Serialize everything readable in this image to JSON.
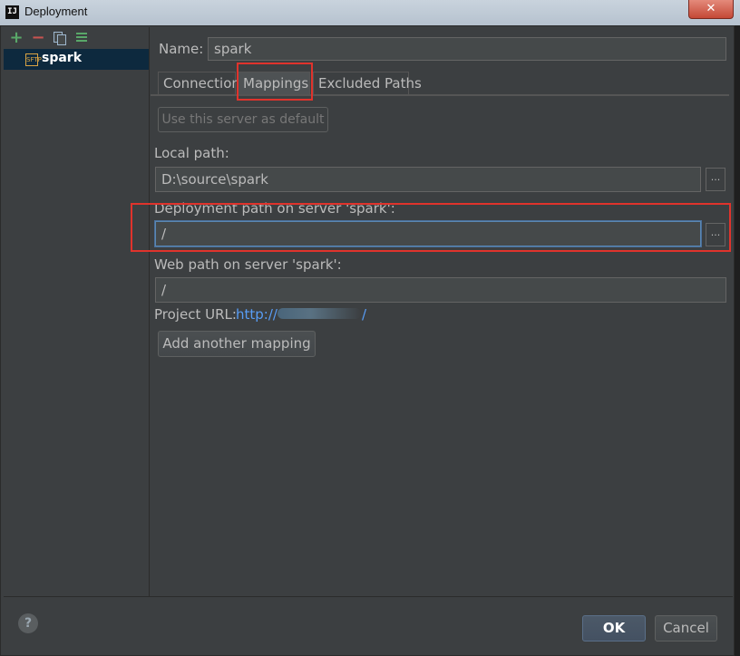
{
  "window": {
    "title": "Deployment",
    "app_icon": "IJ",
    "close_glyph": "✕"
  },
  "toolbar": {
    "add_icon": "plus-icon",
    "remove_icon": "minus-icon",
    "copy_icon": "copy-icon",
    "default_icon": "set-default-icon"
  },
  "servers": {
    "items": [
      {
        "label": "spark",
        "selected": true
      }
    ]
  },
  "form": {
    "name_label": "Name:",
    "name_value": "spark",
    "tabs": [
      {
        "label": "Connection"
      },
      {
        "label": "Mappings",
        "active": true
      },
      {
        "label": "Excluded Paths"
      }
    ],
    "default_button": "Use this server as default",
    "local_path_label": "Local path:",
    "local_path_value": "D:\\source\\spark",
    "deploy_path_label": "Deployment path on server 'spark':",
    "deploy_path_value": "/",
    "web_path_label": "Web path on server 'spark':",
    "web_path_value": "/",
    "project_url_label": "Project URL:",
    "project_url_prefix": "http://",
    "project_url_suffix": "/",
    "add_mapping_button": "Add another mapping",
    "browse_label": "..."
  },
  "footer": {
    "help": "?",
    "ok": "OK",
    "cancel": "Cancel"
  },
  "colors": {
    "background": "#3c3f41",
    "highlight": "#e0332c",
    "link": "#589df6",
    "selection": "#0d293e"
  }
}
